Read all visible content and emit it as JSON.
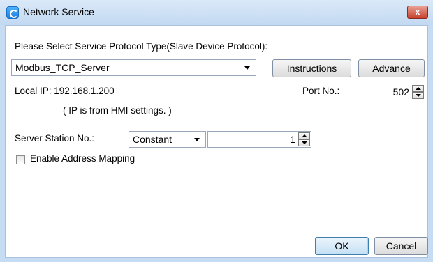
{
  "window": {
    "title": "Network Service",
    "close_label": "x"
  },
  "protocol": {
    "prompt": "Please Select Service Protocol Type(Slave Device Protocol):",
    "selected": "Modbus_TCP_Server",
    "instructions_label": "Instructions",
    "advance_label": "Advance"
  },
  "network": {
    "local_ip_text": "Local IP: 192.168.1.200",
    "ip_note": "( IP is from HMI settings. )",
    "port_label": "Port No.:",
    "port_value": "502"
  },
  "server": {
    "station_label": "Server Station No.:",
    "mode_selected": "Constant",
    "station_value": "1"
  },
  "mapping": {
    "label": "Enable Address Mapping",
    "checked": false
  },
  "footer": {
    "ok_label": "OK",
    "cancel_label": "Cancel"
  },
  "colors": {
    "title_bar": "#c5dcf3",
    "close_button": "#c7402d",
    "default_button_border": "#3c7fb1"
  }
}
